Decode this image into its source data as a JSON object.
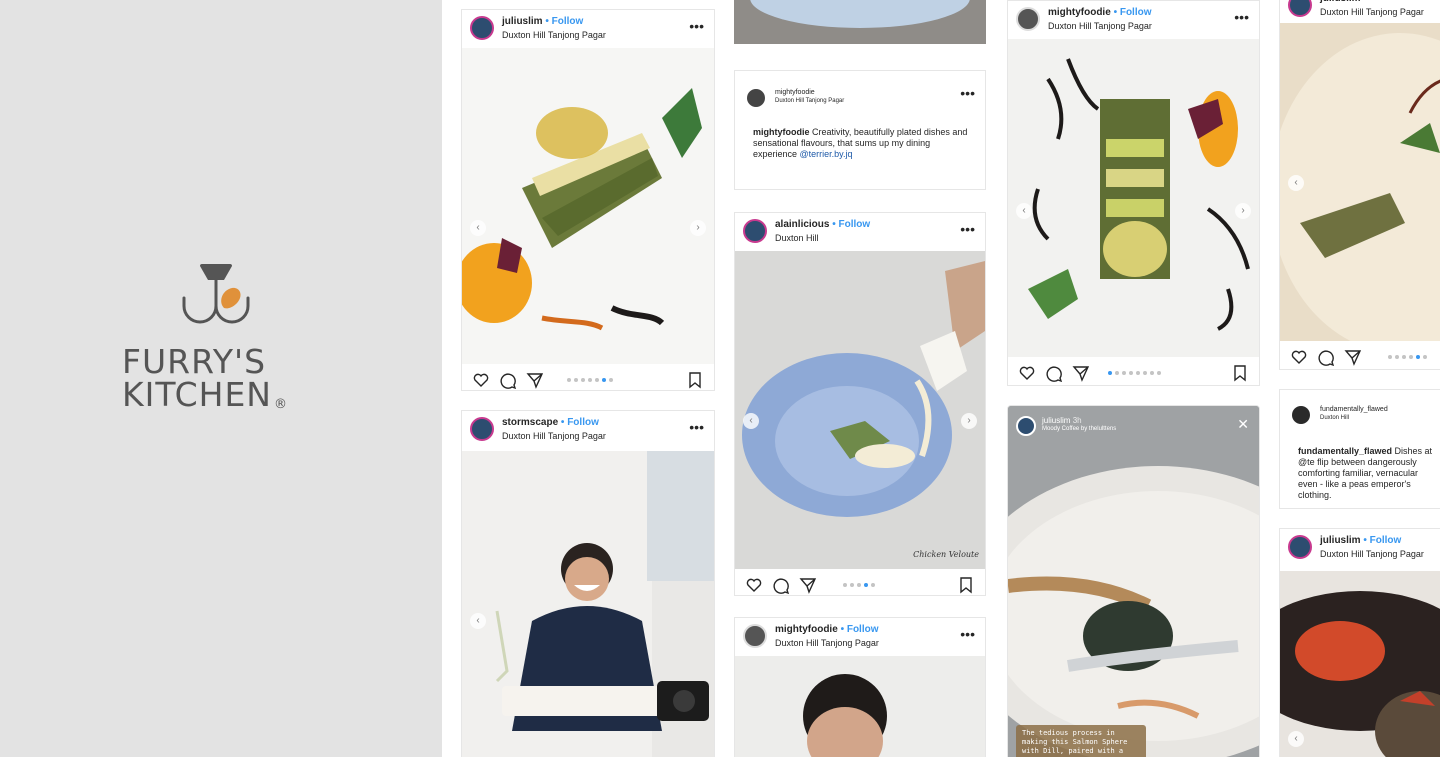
{
  "brand": {
    "line1": "FURRY'S",
    "line2": "KITCHEN",
    "registered": "®",
    "color": "#555555",
    "accent": "#e0913a"
  },
  "posts": [
    {
      "user": "juliuslim",
      "follow": "• Follow",
      "location": "Duxton Hill Tanjong Pagar"
    },
    {
      "user": "stormscape",
      "follow": "• Follow",
      "location": "Duxton Hill Tanjong Pagar"
    },
    {
      "user": "alainlicious",
      "follow": "• Follow",
      "location": "Duxton Hill"
    },
    {
      "user": "mightyfoodie",
      "follow": "• Follow",
      "location": "Duxton Hill Tanjong Pagar"
    },
    {
      "user": "mightyfoodie",
      "follow": "• Follow",
      "location": "Duxton Hill Tanjong Pagar"
    },
    {
      "user": "juliuslim",
      "follow": "",
      "location": "Duxton Hill Tanjong Pagar"
    },
    {
      "user": "juliuslim",
      "follow": "• Follow",
      "location": "Duxton Hill Tanjong Pagar"
    }
  ],
  "caption_post_1": {
    "user": "mightyfoodie",
    "location": "Duxton Hill Tanjong Pagar",
    "caption_user": "mightyfoodie",
    "caption_text": " Creativity, beautifully plated dishes and sensational flavours, that sums up my dining experience ",
    "caption_tag": "@terrier.by.jq"
  },
  "caption_post_2": {
    "user": "fundamentally_flawed",
    "location": "Duxton Hill",
    "caption_user": "fundamentally_flawed",
    "caption_text": " Dishes at @te flip between dangerously comforting familiar, vernacular even - like a peas emperor's clothing."
  },
  "story": {
    "user": "juliuslim",
    "age": "3h",
    "music": "Moody Coffee by thelulttens",
    "text": "The tedious process in making this Salmon Sphere with Dill, paired with a"
  },
  "more_glyph": "•••",
  "photo_signature": "Chicken Veloute"
}
